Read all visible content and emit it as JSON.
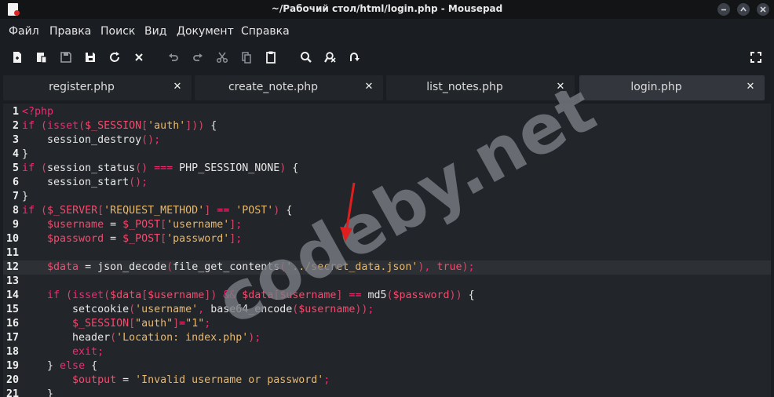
{
  "window": {
    "title": "~/Рабочий стол/html/login.php - Mousepad",
    "buttons": [
      "minimize",
      "maximize",
      "close"
    ]
  },
  "menu": [
    "Файл",
    "Правка",
    "Поиск",
    "Вид",
    "Документ",
    "Справка"
  ],
  "toolbar": {
    "icons": [
      "new-document-icon",
      "new-window-icon",
      "save-icon",
      "save-as-icon",
      "reload-icon",
      "close-document-icon",
      "undo-icon",
      "redo-icon",
      "cut-icon",
      "copy-icon",
      "paste-icon",
      "search-icon",
      "find-replace-icon",
      "go-to-line-icon",
      "fullscreen-icon"
    ]
  },
  "tabs": [
    {
      "label": "register.php",
      "active": false
    },
    {
      "label": "create_note.php",
      "active": false
    },
    {
      "label": "list_notes.php",
      "active": false
    },
    {
      "label": "login.php",
      "active": true
    }
  ],
  "editor": {
    "current_line": 12,
    "lines": [
      [
        {
          "t": "<?php",
          "c": "k"
        }
      ],
      [
        {
          "t": "if ",
          "c": "k"
        },
        {
          "t": "(",
          "c": "p"
        },
        {
          "t": "isset",
          "c": "k"
        },
        {
          "t": "(",
          "c": "p"
        },
        {
          "t": "$_SESSION",
          "c": "v"
        },
        {
          "t": "[",
          "c": "p"
        },
        {
          "t": "'auth'",
          "c": "s"
        },
        {
          "t": "]",
          "c": "p"
        },
        {
          "t": ")",
          "c": "p"
        },
        {
          "t": ")",
          "c": "p"
        },
        {
          "t": " {",
          "c": "d"
        }
      ],
      [
        {
          "t": "    session_destroy",
          "c": "d"
        },
        {
          "t": "()",
          "c": "p"
        },
        {
          "t": ";",
          "c": "k"
        }
      ],
      [
        {
          "t": "}",
          "c": "d"
        }
      ],
      [
        {
          "t": "if ",
          "c": "k"
        },
        {
          "t": "(",
          "c": "p"
        },
        {
          "t": "session_status",
          "c": "d"
        },
        {
          "t": "()",
          "c": "p"
        },
        {
          "t": " === ",
          "c": "o"
        },
        {
          "t": "PHP_SESSION_NONE",
          "c": "d"
        },
        {
          "t": ")",
          "c": "p"
        },
        {
          "t": " {",
          "c": "d"
        }
      ],
      [
        {
          "t": "    session_start",
          "c": "d"
        },
        {
          "t": "()",
          "c": "p"
        },
        {
          "t": ";",
          "c": "k"
        }
      ],
      [
        {
          "t": "}",
          "c": "d"
        }
      ],
      [
        {
          "t": "if ",
          "c": "k"
        },
        {
          "t": "(",
          "c": "p"
        },
        {
          "t": "$_SERVER",
          "c": "v"
        },
        {
          "t": "[",
          "c": "p"
        },
        {
          "t": "'REQUEST_METHOD'",
          "c": "s"
        },
        {
          "t": "]",
          "c": "p"
        },
        {
          "t": " == ",
          "c": "o"
        },
        {
          "t": "'POST'",
          "c": "s"
        },
        {
          "t": ")",
          "c": "p"
        },
        {
          "t": " {",
          "c": "d"
        }
      ],
      [
        {
          "t": "    $username",
          "c": "v"
        },
        {
          "t": " = ",
          "c": "d"
        },
        {
          "t": "$_POST",
          "c": "v"
        },
        {
          "t": "[",
          "c": "p"
        },
        {
          "t": "'username'",
          "c": "s"
        },
        {
          "t": "]",
          "c": "p"
        },
        {
          "t": ";",
          "c": "k"
        }
      ],
      [
        {
          "t": "    $password",
          "c": "v"
        },
        {
          "t": " = ",
          "c": "d"
        },
        {
          "t": "$_POST",
          "c": "v"
        },
        {
          "t": "[",
          "c": "p"
        },
        {
          "t": "'password'",
          "c": "s"
        },
        {
          "t": "]",
          "c": "p"
        },
        {
          "t": ";",
          "c": "k"
        }
      ],
      [],
      [
        {
          "t": "    $data",
          "c": "v"
        },
        {
          "t": " = ",
          "c": "d"
        },
        {
          "t": "json_decode",
          "c": "d"
        },
        {
          "t": "(",
          "c": "p"
        },
        {
          "t": "file_get_contents",
          "c": "d"
        },
        {
          "t": "(",
          "c": "p"
        },
        {
          "t": "'../secret_data.json'",
          "c": "s"
        },
        {
          "t": ")",
          "c": "p"
        },
        {
          "t": ", ",
          "c": "k"
        },
        {
          "t": "true",
          "c": "v"
        },
        {
          "t": ")",
          "c": "p"
        },
        {
          "t": ";",
          "c": "k"
        }
      ],
      [],
      [
        {
          "t": "    if ",
          "c": "k"
        },
        {
          "t": "(",
          "c": "p"
        },
        {
          "t": "isset",
          "c": "k"
        },
        {
          "t": "(",
          "c": "p"
        },
        {
          "t": "$data",
          "c": "v"
        },
        {
          "t": "[",
          "c": "p"
        },
        {
          "t": "$username",
          "c": "v"
        },
        {
          "t": "]",
          "c": "p"
        },
        {
          "t": ")",
          "c": "p"
        },
        {
          "t": " && ",
          "c": "o"
        },
        {
          "t": "$data",
          "c": "v"
        },
        {
          "t": "[",
          "c": "p"
        },
        {
          "t": "$username",
          "c": "v"
        },
        {
          "t": "]",
          "c": "p"
        },
        {
          "t": " == ",
          "c": "o"
        },
        {
          "t": "md5",
          "c": "d"
        },
        {
          "t": "(",
          "c": "p"
        },
        {
          "t": "$password",
          "c": "v"
        },
        {
          "t": ")",
          "c": "p"
        },
        {
          "t": ")",
          "c": "p"
        },
        {
          "t": " {",
          "c": "d"
        }
      ],
      [
        {
          "t": "        setcookie",
          "c": "d"
        },
        {
          "t": "(",
          "c": "p"
        },
        {
          "t": "'username'",
          "c": "s"
        },
        {
          "t": ", ",
          "c": "k"
        },
        {
          "t": "base64_encode",
          "c": "d"
        },
        {
          "t": "(",
          "c": "p"
        },
        {
          "t": "$username",
          "c": "v"
        },
        {
          "t": ")",
          "c": "p"
        },
        {
          "t": ")",
          "c": "p"
        },
        {
          "t": ";",
          "c": "k"
        }
      ],
      [
        {
          "t": "        $_SESSION",
          "c": "v"
        },
        {
          "t": "[",
          "c": "p"
        },
        {
          "t": "\"auth\"",
          "c": "s"
        },
        {
          "t": "]",
          "c": "p"
        },
        {
          "t": "=",
          "c": "o"
        },
        {
          "t": "\"1\"",
          "c": "s"
        },
        {
          "t": ";",
          "c": "k"
        }
      ],
      [
        {
          "t": "        header",
          "c": "d"
        },
        {
          "t": "(",
          "c": "p"
        },
        {
          "t": "'Location: index.php'",
          "c": "s"
        },
        {
          "t": ")",
          "c": "p"
        },
        {
          "t": ";",
          "c": "k"
        }
      ],
      [
        {
          "t": "        exit",
          "c": "k"
        },
        {
          "t": ";",
          "c": "k"
        }
      ],
      [
        {
          "t": "    } ",
          "c": "d"
        },
        {
          "t": "else",
          "c": "k"
        },
        {
          "t": " {",
          "c": "d"
        }
      ],
      [
        {
          "t": "        $output",
          "c": "v"
        },
        {
          "t": " = ",
          "c": "d"
        },
        {
          "t": "'Invalid username or password'",
          "c": "s"
        },
        {
          "t": ";",
          "c": "k"
        }
      ],
      [
        {
          "t": "    }",
          "c": "d"
        }
      ]
    ]
  },
  "watermark": "codeby.net",
  "colors": {
    "background": "#222529",
    "keyword": "#f92672",
    "variable": "#f44b6e",
    "string": "#e8b86d",
    "default": "#e6e6e6",
    "watermark": "#7a7d85",
    "annotation_arrow": "#e01e1e"
  }
}
